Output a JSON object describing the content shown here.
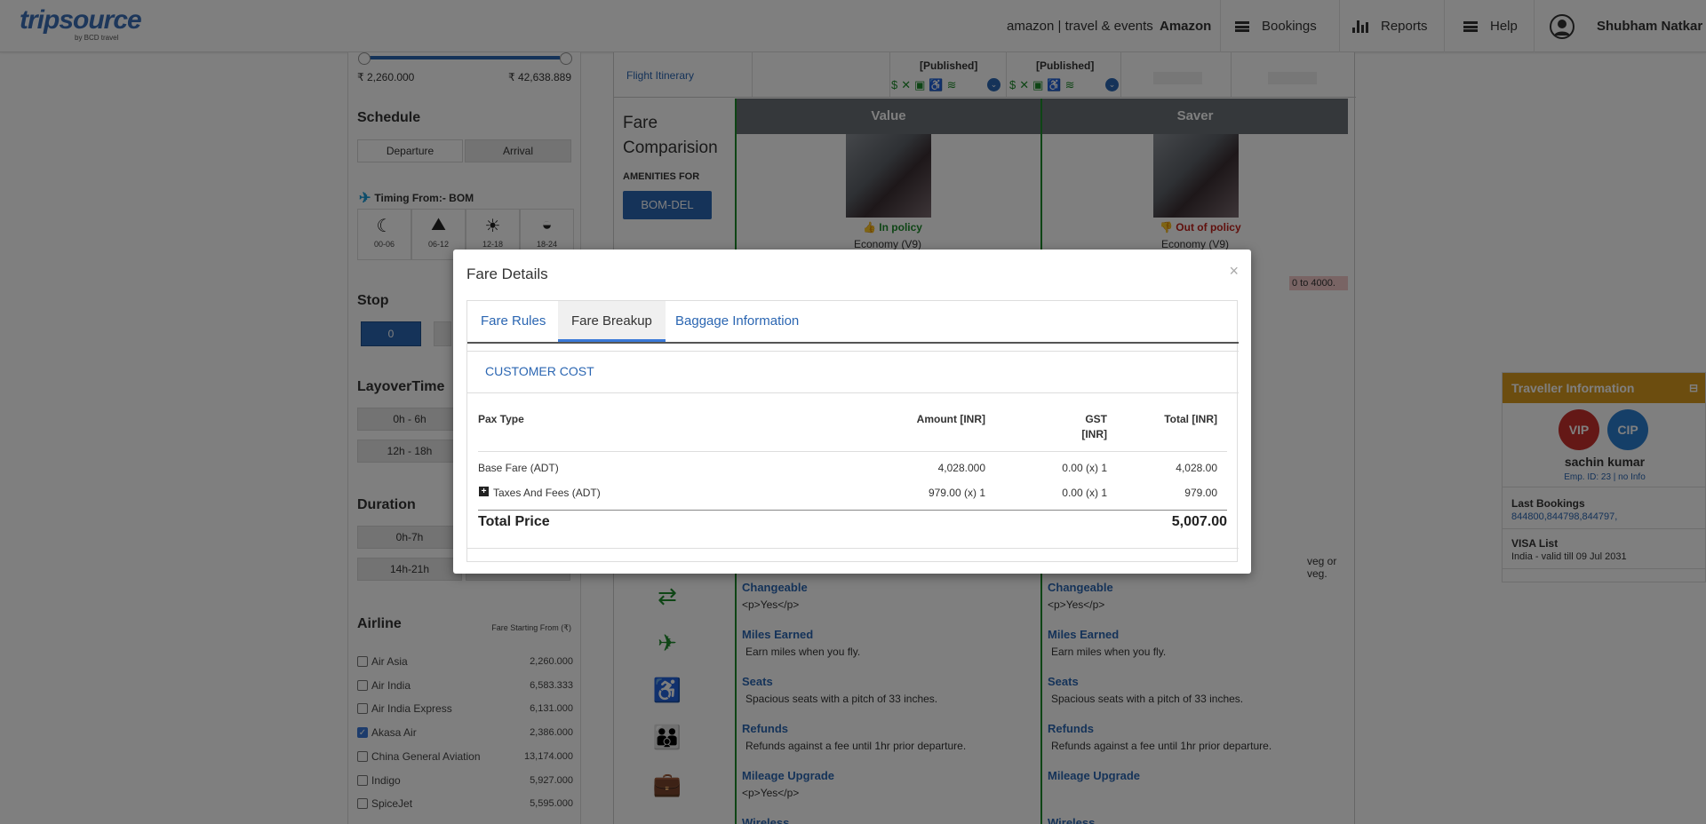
{
  "header": {
    "logo": "tripsource",
    "logo_sub": "by BCD travel",
    "partner": "amazon | travel & events",
    "company": "Amazon",
    "nav": {
      "bookings": "Bookings",
      "reports": "Reports",
      "help": "Help"
    },
    "user": "Shubham Natkar"
  },
  "filters": {
    "price_min": "₹ 2,260.000",
    "price_max": "₹ 42,638.889",
    "schedule_title": "Schedule",
    "schedule_tabs": [
      "Departure",
      "Arrival"
    ],
    "timing_label": "Timing From:- BOM",
    "time_slots": [
      "00-06",
      "06-12",
      "12-18",
      "18-24"
    ],
    "stop_title": "Stop",
    "stop_value": "0",
    "layover_title": "LayoverTime",
    "layover_options": [
      "0h - 6h",
      "12h - 18h"
    ],
    "duration_title": "Duration",
    "duration_options": [
      "0h-7h",
      "14h-21h"
    ],
    "airline_title": "Airline",
    "fare_from": "Fare Starting From (₹)",
    "airlines": [
      {
        "name": "Air Asia",
        "fare": "2,260.000",
        "checked": false
      },
      {
        "name": "Air India",
        "fare": "6,583.333",
        "checked": false
      },
      {
        "name": "Air India Express",
        "fare": "6,131.000",
        "checked": false
      },
      {
        "name": "Akasa Air",
        "fare": "2,386.000",
        "checked": true
      },
      {
        "name": "China General Aviation",
        "fare": "13,174.000",
        "checked": false
      },
      {
        "name": "Indigo",
        "fare": "5,927.000",
        "checked": false
      },
      {
        "name": "SpiceJet",
        "fare": "5,595.000",
        "checked": false
      }
    ]
  },
  "comparison": {
    "flight_itinerary": "Flight Itinerary",
    "published": "[Published]",
    "title": "Fare Comparision",
    "amenities_for": "AMENITIES FOR",
    "route_button": "BOM-DEL",
    "columns": [
      {
        "name": "Value",
        "policy": "In policy",
        "cabin": "Economy (V9)"
      },
      {
        "name": "Saver",
        "policy": "Out of policy",
        "cabin": "Economy (V9)"
      }
    ],
    "partial_note": "0 to 4000.",
    "partial_meal": "veg or veg.",
    "features": [
      {
        "title": "Changeable",
        "desc": "<p>Yes</p>",
        "icon": "exchange-icon"
      },
      {
        "title": "Miles Earned",
        "desc": "Earn miles when you fly.",
        "icon": "plane-icon"
      },
      {
        "title": "Seats",
        "desc": "Spacious seats with a pitch of 33 inches.",
        "icon": "seat-icon"
      },
      {
        "title": "Refunds",
        "desc": "Refunds against a fee until 1hr prior departure.",
        "icon": "people-icon"
      },
      {
        "title": "Mileage Upgrade",
        "desc": "<p>Yes</p>",
        "icon": "briefcase-icon"
      },
      {
        "title": "Wireless",
        "desc": "",
        "icon": "wifi-icon"
      }
    ]
  },
  "traveller": {
    "title": "Traveller Information",
    "badges": [
      "VIP",
      "CIP"
    ],
    "name": "sachin kumar",
    "emp": "Emp. ID: 23 | no Info",
    "last_bookings_label": "Last Bookings",
    "last_bookings": "844800,844798,844797,",
    "visa_label": "VISA List",
    "visa": "India - valid till 09 Jul 2031"
  },
  "modal": {
    "title": "Fare Details",
    "close": "×",
    "tabs": [
      "Fare Rules",
      "Fare Breakup",
      "Baggage Information"
    ],
    "active_tab": "Fare Breakup",
    "section": "CUSTOMER COST",
    "headers": {
      "pax": "Pax Type",
      "amount": "Amount [INR]",
      "gst_1": "GST",
      "gst_2": "[INR]",
      "total": "Total [INR]"
    },
    "rows": [
      {
        "pax": "Base Fare (ADT)",
        "amount": "4,028.000",
        "gst": "0.00 (x) 1",
        "total": "4,028.00"
      },
      {
        "pax": "Taxes And Fees (ADT)",
        "amount": "979.00 (x) 1",
        "gst": "0.00 (x) 1",
        "total": "979.00"
      }
    ],
    "total_label": "Total Price",
    "total_value": "5,007.00"
  }
}
